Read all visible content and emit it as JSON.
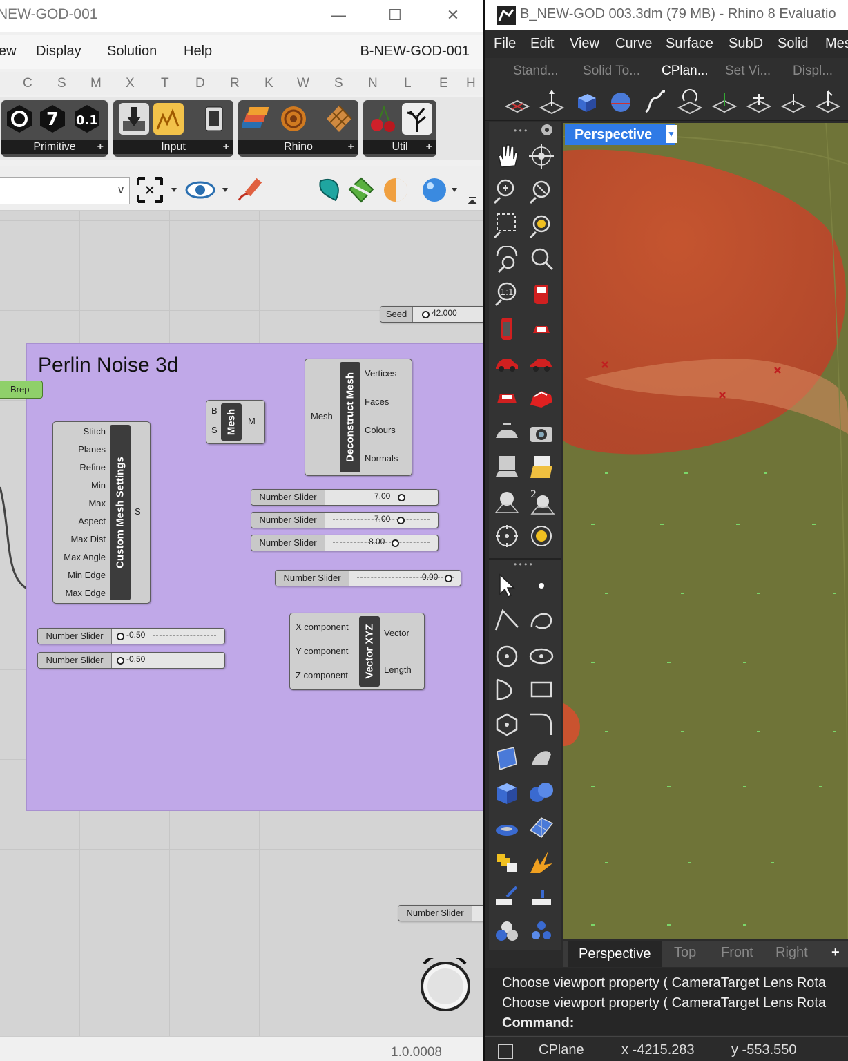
{
  "grasshopper": {
    "window_title": "NEW-GOD-001",
    "window_controls": {
      "minimize": "—",
      "maximize": "☐",
      "close": "✕"
    },
    "menu": [
      "ew",
      "Display",
      "Solution",
      "Help"
    ],
    "document_name": "B-NEW-GOD-001",
    "tabs": [
      "C",
      "S",
      "M",
      "X",
      "T",
      "D",
      "R",
      "K",
      "W",
      "S",
      "N",
      "L",
      "E",
      "H"
    ],
    "ribbon_groups": [
      "Primitive",
      "Input",
      "Rhino",
      "Util"
    ],
    "ribbon_icon_text": {
      "seven": "7",
      "zero_one": "0.1"
    },
    "canvas": {
      "seed": {
        "label": "Seed",
        "value": "42.000"
      },
      "group_title": "Perlin Noise 3d",
      "group_color": "#c0a8e8",
      "brep_param": "Brep",
      "mesh_component": {
        "name": "Mesh",
        "inputs": [
          "B",
          "S"
        ],
        "outputs": [
          "M"
        ]
      },
      "custom_mesh_settings": {
        "name": "Custom Mesh Settings",
        "inputs": [
          "Stitch",
          "Planes",
          "Refine",
          "Min",
          "Max",
          "Aspect",
          "Max Dist",
          "Max Angle",
          "Min Edge",
          "Max Edge"
        ],
        "output": "S"
      },
      "deconstruct_mesh": {
        "name": "Deconstruct Mesh",
        "input": "Mesh",
        "outputs": [
          "Vertices",
          "Faces",
          "Colours",
          "Normals"
        ]
      },
      "sliders": [
        {
          "label": "Number Slider",
          "value": "7.00"
        },
        {
          "label": "Number Slider",
          "value": "7.00"
        },
        {
          "label": "Number Slider",
          "value": "8.00"
        },
        {
          "label": "Number Slider",
          "value": "0.90"
        },
        {
          "label": "Number Slider",
          "value": "-0.50"
        },
        {
          "label": "Number Slider",
          "value": "-0.50"
        },
        {
          "label": "Number Slider",
          "value": ""
        }
      ],
      "vector_xyz": {
        "name": "Vector XYZ",
        "inputs": [
          "X component",
          "Y component",
          "Z component"
        ],
        "outputs": [
          "Vector",
          "Length"
        ]
      }
    },
    "version": "1.0.0008"
  },
  "rhino": {
    "window_title": "B_NEW-GOD 003.3dm (79 MB) - Rhino 8 Evaluatio",
    "menu": [
      "File",
      "Edit",
      "View",
      "Curve",
      "Surface",
      "SubD",
      "Solid",
      "Mes"
    ],
    "toolbar_tabs": [
      "Stand...",
      "Solid To...",
      "CPlan...",
      "Set Vi...",
      "Displ..."
    ],
    "active_toolbar_tab": "CPlan...",
    "viewport_label": "Perspective",
    "viewport_tabs": [
      "Perspective",
      "Top",
      "Front",
      "Right"
    ],
    "add_viewport": "+",
    "command_history": [
      "Choose viewport property ( CameraTarget  Lens  Rota",
      "Choose viewport property ( CameraTarget  Lens  Rota"
    ],
    "command_prompt": "Command:",
    "status": {
      "cplane": "CPlane",
      "x": "x -4215.283",
      "y": "y -553.550"
    },
    "colors": {
      "viewport_bg": "#6f7438",
      "surface": "#c64a2e",
      "accent": "#2f7ae6"
    }
  }
}
